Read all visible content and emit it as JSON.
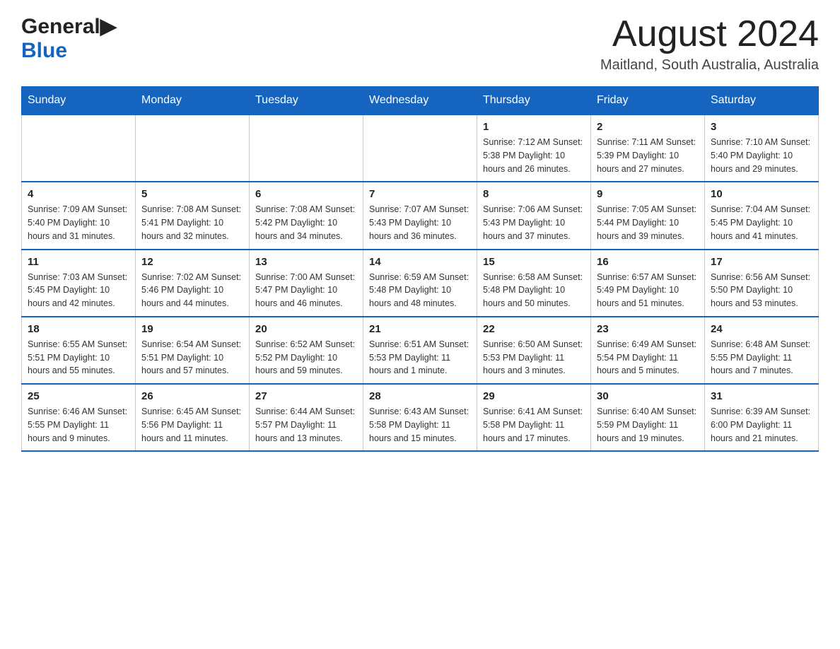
{
  "header": {
    "logo_line1": "General",
    "logo_line2": "Blue",
    "title": "August 2024",
    "location": "Maitland, South Australia, Australia"
  },
  "days_of_week": [
    "Sunday",
    "Monday",
    "Tuesday",
    "Wednesday",
    "Thursday",
    "Friday",
    "Saturday"
  ],
  "weeks": [
    [
      {
        "day": "",
        "info": ""
      },
      {
        "day": "",
        "info": ""
      },
      {
        "day": "",
        "info": ""
      },
      {
        "day": "",
        "info": ""
      },
      {
        "day": "1",
        "info": "Sunrise: 7:12 AM\nSunset: 5:38 PM\nDaylight: 10 hours and 26 minutes."
      },
      {
        "day": "2",
        "info": "Sunrise: 7:11 AM\nSunset: 5:39 PM\nDaylight: 10 hours and 27 minutes."
      },
      {
        "day": "3",
        "info": "Sunrise: 7:10 AM\nSunset: 5:40 PM\nDaylight: 10 hours and 29 minutes."
      }
    ],
    [
      {
        "day": "4",
        "info": "Sunrise: 7:09 AM\nSunset: 5:40 PM\nDaylight: 10 hours and 31 minutes."
      },
      {
        "day": "5",
        "info": "Sunrise: 7:08 AM\nSunset: 5:41 PM\nDaylight: 10 hours and 32 minutes."
      },
      {
        "day": "6",
        "info": "Sunrise: 7:08 AM\nSunset: 5:42 PM\nDaylight: 10 hours and 34 minutes."
      },
      {
        "day": "7",
        "info": "Sunrise: 7:07 AM\nSunset: 5:43 PM\nDaylight: 10 hours and 36 minutes."
      },
      {
        "day": "8",
        "info": "Sunrise: 7:06 AM\nSunset: 5:43 PM\nDaylight: 10 hours and 37 minutes."
      },
      {
        "day": "9",
        "info": "Sunrise: 7:05 AM\nSunset: 5:44 PM\nDaylight: 10 hours and 39 minutes."
      },
      {
        "day": "10",
        "info": "Sunrise: 7:04 AM\nSunset: 5:45 PM\nDaylight: 10 hours and 41 minutes."
      }
    ],
    [
      {
        "day": "11",
        "info": "Sunrise: 7:03 AM\nSunset: 5:45 PM\nDaylight: 10 hours and 42 minutes."
      },
      {
        "day": "12",
        "info": "Sunrise: 7:02 AM\nSunset: 5:46 PM\nDaylight: 10 hours and 44 minutes."
      },
      {
        "day": "13",
        "info": "Sunrise: 7:00 AM\nSunset: 5:47 PM\nDaylight: 10 hours and 46 minutes."
      },
      {
        "day": "14",
        "info": "Sunrise: 6:59 AM\nSunset: 5:48 PM\nDaylight: 10 hours and 48 minutes."
      },
      {
        "day": "15",
        "info": "Sunrise: 6:58 AM\nSunset: 5:48 PM\nDaylight: 10 hours and 50 minutes."
      },
      {
        "day": "16",
        "info": "Sunrise: 6:57 AM\nSunset: 5:49 PM\nDaylight: 10 hours and 51 minutes."
      },
      {
        "day": "17",
        "info": "Sunrise: 6:56 AM\nSunset: 5:50 PM\nDaylight: 10 hours and 53 minutes."
      }
    ],
    [
      {
        "day": "18",
        "info": "Sunrise: 6:55 AM\nSunset: 5:51 PM\nDaylight: 10 hours and 55 minutes."
      },
      {
        "day": "19",
        "info": "Sunrise: 6:54 AM\nSunset: 5:51 PM\nDaylight: 10 hours and 57 minutes."
      },
      {
        "day": "20",
        "info": "Sunrise: 6:52 AM\nSunset: 5:52 PM\nDaylight: 10 hours and 59 minutes."
      },
      {
        "day": "21",
        "info": "Sunrise: 6:51 AM\nSunset: 5:53 PM\nDaylight: 11 hours and 1 minute."
      },
      {
        "day": "22",
        "info": "Sunrise: 6:50 AM\nSunset: 5:53 PM\nDaylight: 11 hours and 3 minutes."
      },
      {
        "day": "23",
        "info": "Sunrise: 6:49 AM\nSunset: 5:54 PM\nDaylight: 11 hours and 5 minutes."
      },
      {
        "day": "24",
        "info": "Sunrise: 6:48 AM\nSunset: 5:55 PM\nDaylight: 11 hours and 7 minutes."
      }
    ],
    [
      {
        "day": "25",
        "info": "Sunrise: 6:46 AM\nSunset: 5:55 PM\nDaylight: 11 hours and 9 minutes."
      },
      {
        "day": "26",
        "info": "Sunrise: 6:45 AM\nSunset: 5:56 PM\nDaylight: 11 hours and 11 minutes."
      },
      {
        "day": "27",
        "info": "Sunrise: 6:44 AM\nSunset: 5:57 PM\nDaylight: 11 hours and 13 minutes."
      },
      {
        "day": "28",
        "info": "Sunrise: 6:43 AM\nSunset: 5:58 PM\nDaylight: 11 hours and 15 minutes."
      },
      {
        "day": "29",
        "info": "Sunrise: 6:41 AM\nSunset: 5:58 PM\nDaylight: 11 hours and 17 minutes."
      },
      {
        "day": "30",
        "info": "Sunrise: 6:40 AM\nSunset: 5:59 PM\nDaylight: 11 hours and 19 minutes."
      },
      {
        "day": "31",
        "info": "Sunrise: 6:39 AM\nSunset: 6:00 PM\nDaylight: 11 hours and 21 minutes."
      }
    ]
  ]
}
